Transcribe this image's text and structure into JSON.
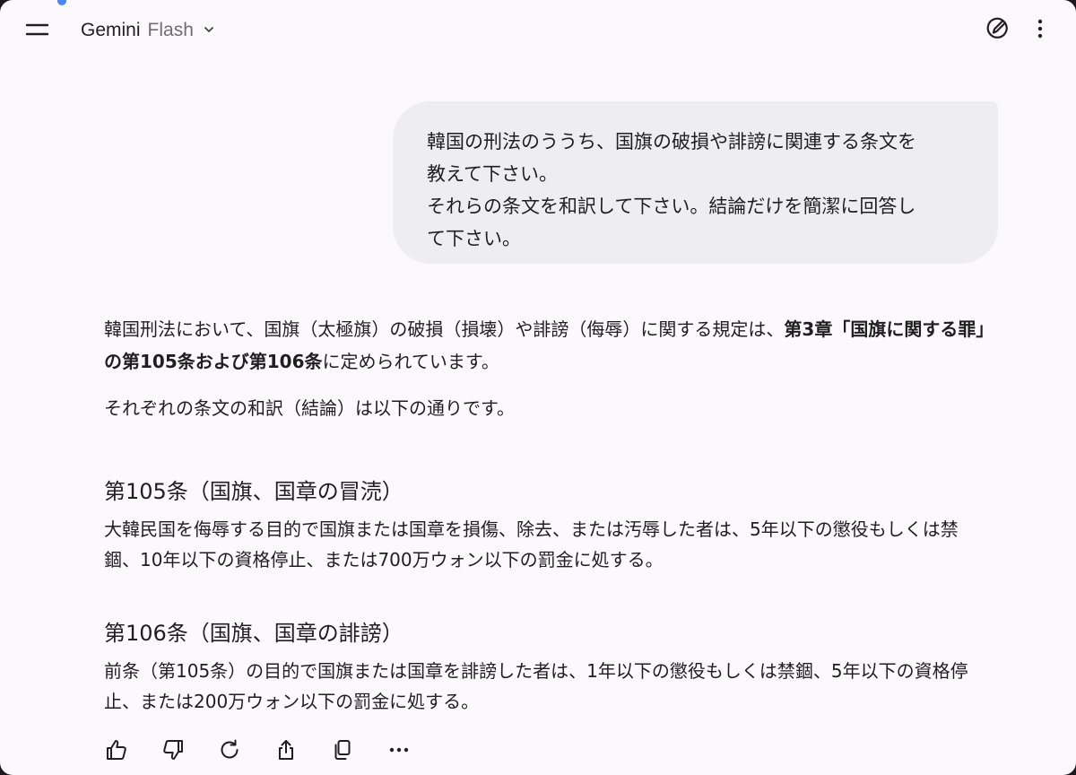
{
  "header": {
    "model_name": "Gemini",
    "model_variant": "Flash",
    "icons": {
      "menu": "menu-icon",
      "model_dropdown": "chevron-down-icon",
      "new_chat": "edit-pen-icon",
      "more": "more-vertical-icon"
    }
  },
  "user_message": {
    "lines": [
      "韓国の刑法のううち、国旗の破損や誹謗に関連する条文を",
      "教えて下さい。",
      "それらの条文を和訳して下さい。結論だけを簡潔に回答し",
      "て下さい。"
    ]
  },
  "response": {
    "intro_prefix": "韓国刑法において、国旗（太極旗）の破損（損壊）や誹謗（侮辱）に関する規定は、",
    "intro_bold": "第3章「国旗に関する罪」の第105条および第106条",
    "intro_suffix": "に定められています。",
    "summary": "それぞれの条文の和訳（結論）は以下の通りです。",
    "sections": [
      {
        "heading": "第105条（国旗、国章の冒涜）",
        "body": "大韓民国を侮辱する目的で国旗または国章を損傷、除去、または汚辱した者は、5年以下の懲役もしくは禁錮、10年以下の資格停止、または700万ウォン以下の罰金に処する。"
      },
      {
        "heading": "第106条（国旗、国章の誹謗）",
        "body": "前条（第105条）の目的で国旗または国章を誹謗した者は、1年以下の懲役もしくは禁錮、5年以下の資格停止、または200万ウォン以下の罰金に処する。"
      }
    ]
  },
  "actions": {
    "icons": [
      "thumbs-up-icon",
      "thumbs-down-icon",
      "regenerate-icon",
      "share-icon",
      "copy-icon",
      "more-horizontal-icon"
    ]
  },
  "colors": {
    "background": "#fbf9fb",
    "bubble": "#eeedf0",
    "text": "#1f1f1f",
    "muted_text": "#6f6f6f",
    "accent": "#4a86f4"
  }
}
